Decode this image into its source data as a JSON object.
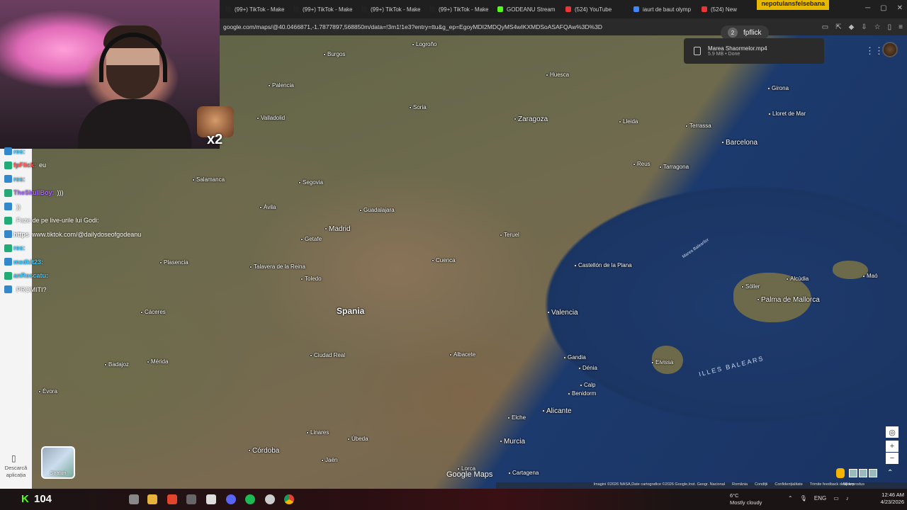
{
  "browser": {
    "tabs": [
      {
        "label": "(99+) TikTok - Make",
        "color": "#222"
      },
      {
        "label": "(99+) TikTok - Make",
        "color": "#222"
      },
      {
        "label": "(99+) TikTok - Make",
        "color": "#222"
      },
      {
        "label": "(99+) TikTok - Make",
        "color": "#222"
      },
      {
        "label": "GODEANU Stream",
        "color": "#53fc18"
      },
      {
        "label": "(524) YouTube",
        "color": "#e33"
      },
      {
        "label": "iaurt de baut olymp",
        "color": "#4285f4"
      },
      {
        "label": "(524) New",
        "color": "#e33"
      }
    ],
    "alert_tab": "nepotulansfelsebana",
    "alert_sub": "Google Maps",
    "url": "google.com/maps/@40.0466871,-1.7877897,568850m/data=!3m1!1e3?entry=ttu&g_ep=EgoyMDI2MDQyMS4wIKXMDSoASAFQAw%3D%3D",
    "profile_name": "fpflick",
    "profile_num": "2",
    "download": {
      "name": "Marea Shaormelor.mp4",
      "meta": "5.9 MB • Done"
    }
  },
  "map": {
    "country": "Spania",
    "sea": "ILLES BALEARS",
    "coast": "Marea Balearilor",
    "cities": [
      {
        "name": "Logroño",
        "size": "small"
      },
      {
        "name": "Burgos",
        "size": "small"
      },
      {
        "name": "Huesca",
        "size": "small"
      },
      {
        "name": "Girona",
        "size": "small"
      },
      {
        "name": "Palencia",
        "size": "small"
      },
      {
        "name": "Zaragoza",
        "size": "big"
      },
      {
        "name": "Lleida",
        "size": "small"
      },
      {
        "name": "Lloret de Mar",
        "size": "small"
      },
      {
        "name": "Valladolid",
        "size": "small"
      },
      {
        "name": "Soria",
        "size": "small"
      },
      {
        "name": "Terrassa",
        "size": "small"
      },
      {
        "name": "Barcelona",
        "size": "big"
      },
      {
        "name": "Reus",
        "size": "small"
      },
      {
        "name": "Tarragona",
        "size": "small"
      },
      {
        "name": "Salamanca",
        "size": "small"
      },
      {
        "name": "Segovia",
        "size": "small"
      },
      {
        "name": "Ávila",
        "size": "small"
      },
      {
        "name": "Guadalajara",
        "size": "small"
      },
      {
        "name": "Madrid",
        "size": "big"
      },
      {
        "name": "Getafe",
        "size": "small"
      },
      {
        "name": "Teruel",
        "size": "small"
      },
      {
        "name": "Plasencia",
        "size": "small"
      },
      {
        "name": "Talavera de la Reina",
        "size": "small"
      },
      {
        "name": "Toledo",
        "size": "small"
      },
      {
        "name": "Cuenca",
        "size": "small"
      },
      {
        "name": "Castellón de la Plana",
        "size": "small"
      },
      {
        "name": "Cáceres",
        "size": "small"
      },
      {
        "name": "Valencia",
        "size": "big"
      },
      {
        "name": "Ciudad Real",
        "size": "small"
      },
      {
        "name": "Albacete",
        "size": "small"
      },
      {
        "name": "Gandia",
        "size": "small"
      },
      {
        "name": "Dénia",
        "size": "small"
      },
      {
        "name": "Calp",
        "size": "small"
      },
      {
        "name": "Benidorm",
        "size": "small"
      },
      {
        "name": "Badajoz",
        "size": "small"
      },
      {
        "name": "Mérida",
        "size": "small"
      },
      {
        "name": "Alicante",
        "size": "big"
      },
      {
        "name": "Évora",
        "size": "small"
      },
      {
        "name": "Elche",
        "size": "small"
      },
      {
        "name": "Murcia",
        "size": "big"
      },
      {
        "name": "Linares",
        "size": "small"
      },
      {
        "name": "Úbeda",
        "size": "small"
      },
      {
        "name": "Córdoba",
        "size": "big"
      },
      {
        "name": "Jaén",
        "size": "small"
      },
      {
        "name": "Lorca",
        "size": "small"
      },
      {
        "name": "Cartagena",
        "size": "small"
      },
      {
        "name": "Sóller",
        "size": "small"
      },
      {
        "name": "Alcúdia",
        "size": "small"
      },
      {
        "name": "Palma de Mallorca",
        "size": "big"
      },
      {
        "name": "Maó",
        "size": "small"
      },
      {
        "name": "Eivissa",
        "size": "small"
      }
    ],
    "google_logo": "Google Maps",
    "attribution": [
      "Imagini ©2026 NASA,Date cartografice ©2026 Google,Inst. Geogr. Nacional",
      "România",
      "Condiții",
      "Confidențialitate",
      "Trimite feedback despre produs"
    ],
    "scale": "50 km",
    "layers_label": "Straturi",
    "rail_text": "Descarcă aplicația"
  },
  "chat": [
    {
      "user": "res:",
      "msg": "",
      "color": "#4cf"
    },
    {
      "user": "fpFlick:",
      "msg": "eu",
      "color": "#f55"
    },
    {
      "user": "res:",
      "msg": "",
      "color": "#4cf"
    },
    {
      "user": "TheSkullBoy:",
      "msg": ")))",
      "color": "#a6f"
    },
    {
      "user": "",
      "msg": "))",
      "color": "#f55"
    },
    {
      "user": "",
      "msg": "Faze de pe live-urile lui Godi:",
      "color": "#f55"
    },
    {
      "user": "https",
      "msg": "www.tiktok.com/@dailydoseofgodeanu",
      "color": "#fff"
    },
    {
      "user": "res:",
      "msg": "",
      "color": "#4cf"
    },
    {
      "user": "medkit23:",
      "msg": "",
      "color": "#4cf"
    },
    {
      "user": "anRoscatu:",
      "msg": "",
      "color": "#4cf"
    },
    {
      "user": "",
      "msg": "PROMITI?",
      "color": "#f55"
    }
  ],
  "overlay": {
    "emote_text": "x2",
    "kick_count": "104",
    "kick_letter": "K"
  },
  "taskbar": {
    "weather_temp": "6°C",
    "weather_desc": "Mostly cloudy",
    "lang": "ENG",
    "time": "12:46 AM",
    "date": "4/23/2026"
  }
}
